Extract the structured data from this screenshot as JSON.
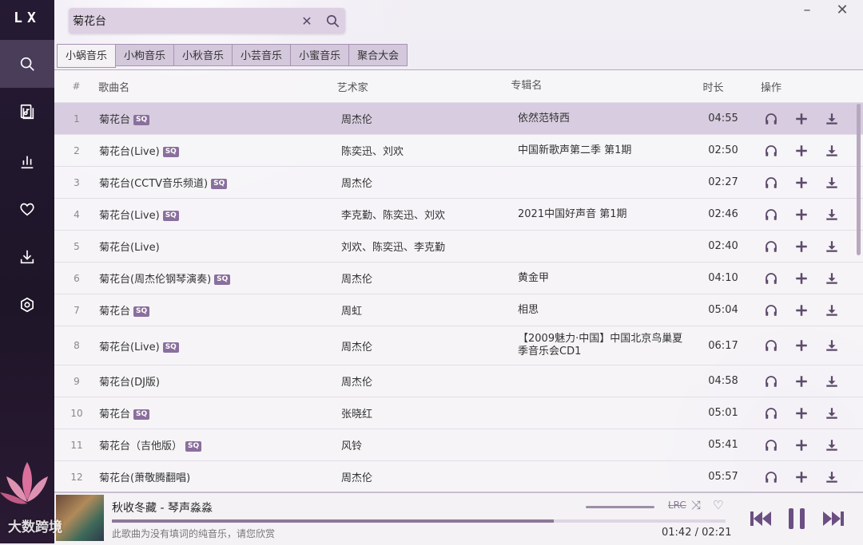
{
  "app": {
    "logo": "LX"
  },
  "search": {
    "value": "菊花台"
  },
  "tabs": [
    "小蜗音乐",
    "小枸音乐",
    "小秋音乐",
    "小芸音乐",
    "小蜜音乐",
    "聚合大会"
  ],
  "table": {
    "headers": {
      "num": "#",
      "name": "歌曲名",
      "artist": "艺术家",
      "album": "专辑名",
      "duration": "时长",
      "actions": "操作"
    },
    "rows": [
      {
        "num": "1",
        "name": "菊花台",
        "sq": "SQ",
        "artist": "周杰伦",
        "album": "依然范特西",
        "duration": "04:55"
      },
      {
        "num": "2",
        "name": "菊花台(Live)",
        "sq": "SQ",
        "artist": "陈奕迅、刘欢",
        "album": "中国新歌声第二季 第1期",
        "duration": "02:50"
      },
      {
        "num": "3",
        "name": "菊花台(CCTV音乐频道)",
        "sq": "SQ",
        "artist": "周杰伦",
        "album": "",
        "duration": "02:27"
      },
      {
        "num": "4",
        "name": "菊花台(Live)",
        "sq": "SQ",
        "artist": "李克勤、陈奕迅、刘欢",
        "album": "2021中国好声音 第1期",
        "duration": "02:46"
      },
      {
        "num": "5",
        "name": "菊花台(Live)",
        "sq": "",
        "artist": "刘欢、陈奕迅、李克勤",
        "album": "",
        "duration": "02:40"
      },
      {
        "num": "6",
        "name": "菊花台(周杰伦钢琴演奏)",
        "sq": "SQ",
        "artist": "周杰伦",
        "album": "黄金甲",
        "duration": "04:10"
      },
      {
        "num": "7",
        "name": "菊花台",
        "sq": "SQ",
        "artist": "周虹",
        "album": "相思",
        "duration": "05:04"
      },
      {
        "num": "8",
        "name": "菊花台(Live)",
        "sq": "SQ",
        "artist": "周杰伦",
        "album": "【2009魅力·中国】中国北京鸟巢夏季音乐会CD1",
        "duration": "06:17"
      },
      {
        "num": "9",
        "name": "菊花台(DJ版)",
        "sq": "",
        "artist": "周杰伦",
        "album": "",
        "duration": "04:58"
      },
      {
        "num": "10",
        "name": "菊花台",
        "sq": "SQ",
        "artist": "张晓红",
        "album": "",
        "duration": "05:01"
      },
      {
        "num": "11",
        "name": "菊花台（吉他版）",
        "sq": "SQ",
        "artist": "风铃",
        "album": "",
        "duration": "05:41"
      },
      {
        "num": "12",
        "name": "菊花台(萧敬腾翻唱)",
        "sq": "",
        "artist": "周杰伦",
        "album": "",
        "duration": "05:57"
      }
    ]
  },
  "player": {
    "title": "秋收冬藏 - 琴声淼淼",
    "lyric": "此歌曲为没有填词的纯音乐，请您欣赏",
    "time": "01:42 / 02:21",
    "progress": 0.72,
    "lrc_label": "LRC"
  },
  "watermark": "大数跨境",
  "colors": {
    "sidebar": "#221830",
    "accent": "#5d4a6b",
    "selected_row": "#d8cde0"
  }
}
